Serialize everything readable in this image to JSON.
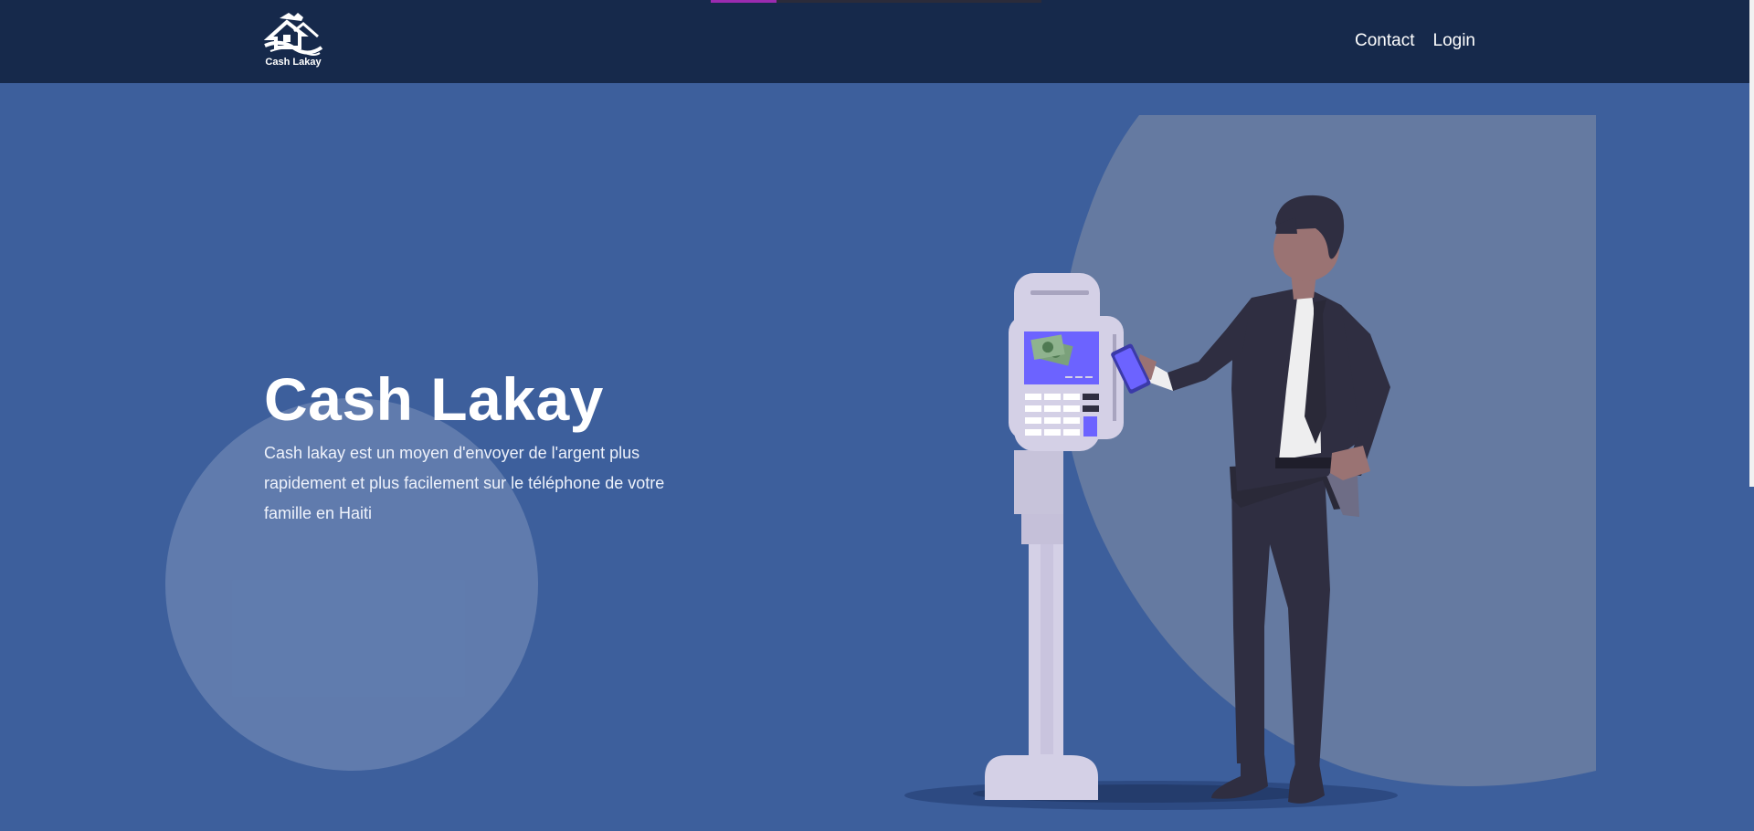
{
  "nav": {
    "logo_text": "Cash Lakay",
    "links": [
      {
        "label": "Contact"
      },
      {
        "label": "Login"
      }
    ]
  },
  "hero": {
    "title": "Cash Lakay",
    "description": "Cash lakay est un moyen d'envoyer de l'argent plus rapidement et plus facilement sur le téléphone de votre famille en Haiti"
  },
  "illustration": {
    "subject": "man-paying-with-phone-at-payment-terminal-icon"
  },
  "colors": {
    "navbar": "#16294b",
    "hero_background": "#3d5f9c",
    "loader_accent": "#9b2bb0",
    "suit": "#2f2e41",
    "terminal": "#d4d0e6",
    "screen": "#6c63ff"
  }
}
